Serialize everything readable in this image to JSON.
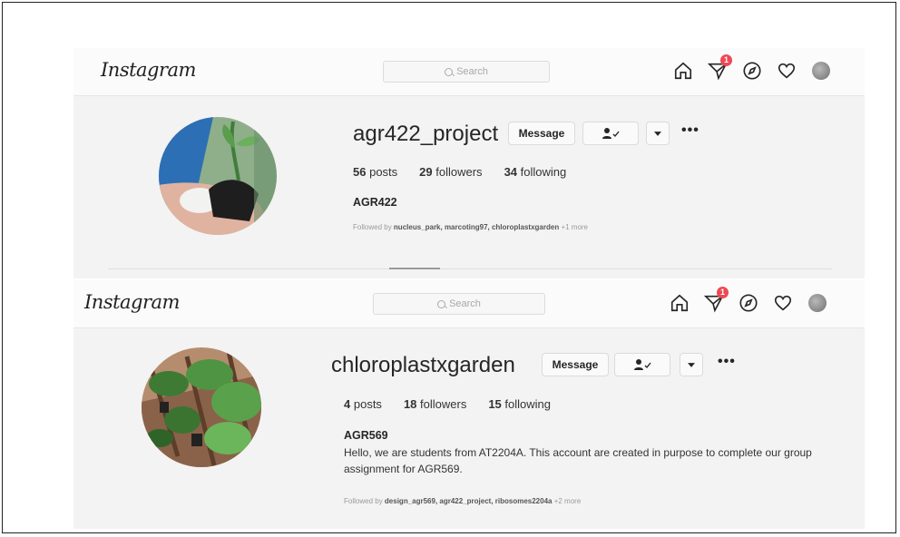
{
  "profiles": [
    {
      "logo": "Instagram",
      "search_placeholder": "Search",
      "notification_count": "1",
      "username": "agr422_project",
      "message_label": "Message",
      "posts": {
        "count": "56",
        "label": "posts"
      },
      "followers": {
        "count": "29",
        "label": "followers"
      },
      "following": {
        "count": "34",
        "label": "following"
      },
      "bio_name": "AGR422",
      "bio_text": "",
      "followed_by_prefix": "Followed by",
      "followed_by_names": "nucleus_park, marcoting97, chloroplastxgarden",
      "followed_by_more": "+1 more"
    },
    {
      "logo": "Instagram",
      "search_placeholder": "Search",
      "notification_count": "1",
      "username": "chloroplastxgarden",
      "message_label": "Message",
      "posts": {
        "count": "4",
        "label": "posts"
      },
      "followers": {
        "count": "18",
        "label": "followers"
      },
      "following": {
        "count": "15",
        "label": "following"
      },
      "bio_name": "AGR569",
      "bio_text": "Hello, we are students from AT2204A. This account are created in purpose to complete our group assignment for AGR569.",
      "followed_by_prefix": "Followed by",
      "followed_by_names": "design_agr569, agr422_project, ribosomes2204a",
      "followed_by_more": "+2 more"
    }
  ],
  "icons": [
    "home-icon",
    "direct-message-icon",
    "explore-compass-icon",
    "heart-icon",
    "profile-avatar-icon",
    "person-check-icon",
    "chevron-down-icon",
    "more-options-icon"
  ],
  "colors": {
    "badge": "#ed4956",
    "text": "#262626",
    "background": "#f3f3f3"
  }
}
